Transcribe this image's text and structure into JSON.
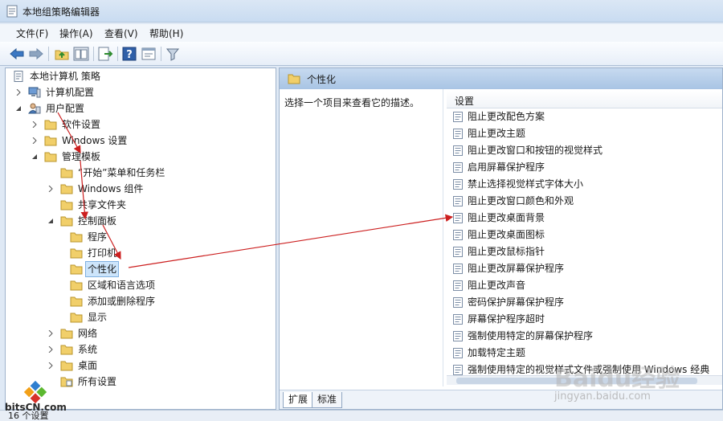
{
  "window": {
    "title": "本地组策略编辑器"
  },
  "menu": [
    {
      "id": "file",
      "label": "文件(F)"
    },
    {
      "id": "action",
      "label": "操作(A)"
    },
    {
      "id": "view",
      "label": "查看(V)"
    },
    {
      "id": "help",
      "label": "帮助(H)"
    }
  ],
  "tree": {
    "root": "本地计算机 策略",
    "computer_config": "计算机配置",
    "user_config": "用户配置",
    "software_settings": "软件设置",
    "windows_settings": "Windows 设置",
    "admin_templates": "管理模板",
    "start_menu": "“开始”菜单和任务栏",
    "windows_components": "Windows 组件",
    "shared_folders": "共享文件夹",
    "control_panel": "控制面板",
    "programs": "程序",
    "printers": "打印机",
    "personalization": "个性化",
    "regional": "区域和语言选项",
    "add_remove": "添加或删除程序",
    "display": "显示",
    "network": "网络",
    "system": "系统",
    "desktop": "桌面",
    "all_settings": "所有设置"
  },
  "right_pane": {
    "header": "个性化",
    "description": "选择一个项目来查看它的描述。",
    "column_header": "设置",
    "settings": [
      "阻止更改配色方案",
      "阻止更改主题",
      "阻止更改窗口和按钮的视觉样式",
      "启用屏幕保护程序",
      "禁止选择视觉样式字体大小",
      "阻止更改窗口颜色和外观",
      "阻止更改桌面背景",
      "阻止更改桌面图标",
      "阻止更改鼠标指针",
      "阻止更改屏幕保护程序",
      "阻止更改声音",
      "密码保护屏幕保护程序",
      "屏幕保护程序超时",
      "强制使用特定的屏幕保护程序",
      "加载特定主题",
      "强制使用特定的视觉样式文件或强制使用 Windows 经典"
    ],
    "tabs": {
      "extended": "扩展",
      "standard": "标准"
    }
  },
  "status": {
    "text": "16 个设置"
  },
  "watermarks": {
    "left": "bitsCN.com",
    "baidu": "Baidu经验",
    "baidu_url": "jingyan.baidu.com"
  },
  "colors": {
    "folder": "#f1cf6a",
    "arrow": "#cc1f1f",
    "header_bg": "#b7cfe9"
  }
}
